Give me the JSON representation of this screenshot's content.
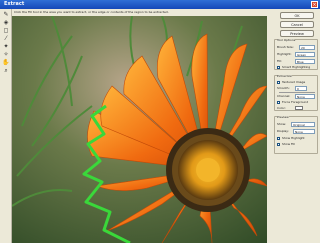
{
  "window": {
    "title": "Extract"
  },
  "instructions": "Click the Fill tool in the area you want to extract, or the edge or contents of the region to be extracted.",
  "tools": [
    {
      "icon": "edge-highlighter-icon",
      "glyph": "✎"
    },
    {
      "icon": "fill-icon",
      "glyph": "◈"
    },
    {
      "icon": "eraser-icon",
      "glyph": "◻"
    },
    {
      "icon": "eyedropper-icon",
      "glyph": "⁄"
    },
    {
      "icon": "cleanup-icon",
      "glyph": "✦"
    },
    {
      "icon": "edge-touchup-icon",
      "glyph": "✧"
    },
    {
      "icon": "hand-icon",
      "glyph": "✋"
    },
    {
      "icon": "zoom-icon",
      "glyph": "⌕"
    }
  ],
  "buttons": {
    "ok": "OK",
    "cancel": "Cancel",
    "preview": "Preview"
  },
  "tool_options": {
    "title": "Tool Options",
    "brush_size_label": "Brush Size:",
    "brush_size_value": "20",
    "highlight_label": "Highlight:",
    "highlight_value": "Green",
    "fill_label": "Fill:",
    "fill_value": "Blue",
    "smart_highlighting_label": "Smart Highlighting"
  },
  "extraction": {
    "title": "Extraction",
    "textured_image_label": "Textured Image",
    "smooth_label": "Smooth:",
    "smooth_value": "0",
    "channel_label": "Channel:",
    "channel_value": "None",
    "force_foreground_label": "Force Foreground",
    "color_label": "Color:"
  },
  "preview": {
    "title": "Preview",
    "show_label": "Show:",
    "show_value": "Original",
    "display_label": "Display:",
    "display_value": "None",
    "show_highlight_label": "Show Highlight",
    "show_fill_label": "Show Fill"
  },
  "colors": {
    "highlight": "#3ad83a",
    "accent": "#1448b8"
  }
}
